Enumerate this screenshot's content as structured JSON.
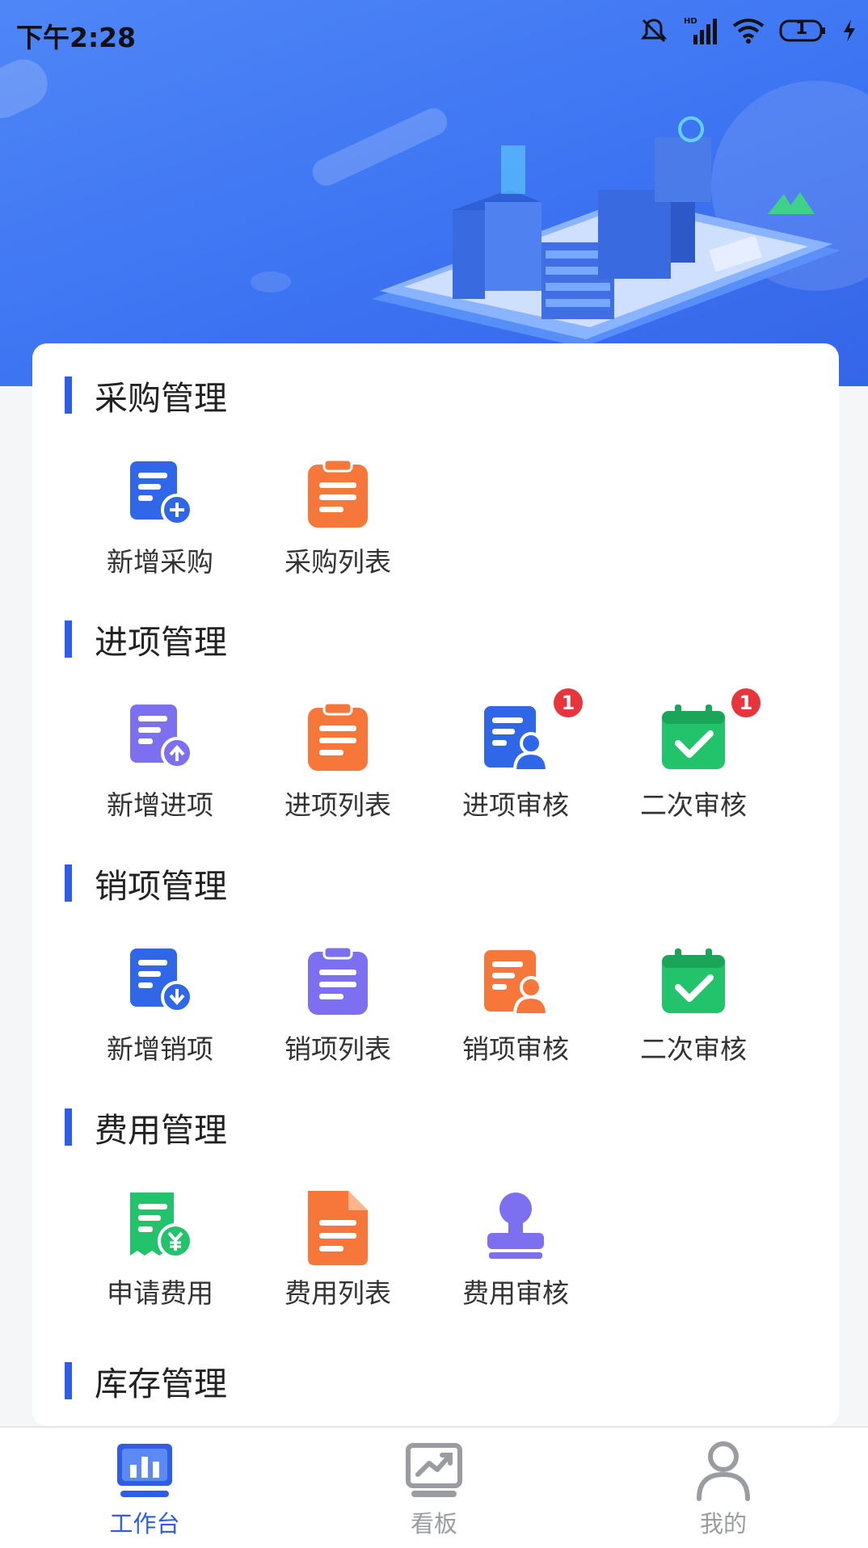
{
  "status_bar": {
    "time": "下午2:28",
    "battery": "1",
    "network": "HD"
  },
  "sections": [
    {
      "title": "采购管理",
      "items": [
        {
          "label": "新增采购",
          "icon": "doc-add-icon",
          "badge": ""
        },
        {
          "label": "采购列表",
          "icon": "clipboard-list-icon",
          "badge": ""
        }
      ]
    },
    {
      "title": "进项管理",
      "items": [
        {
          "label": "新增进项",
          "icon": "doc-upload-icon",
          "badge": ""
        },
        {
          "label": "进项列表",
          "icon": "clipboard-list-icon",
          "badge": ""
        },
        {
          "label": "进项审核",
          "icon": "doc-user-icon",
          "badge": "1"
        },
        {
          "label": "二次审核",
          "icon": "calendar-check-icon",
          "badge": "1"
        }
      ]
    },
    {
      "title": "销项管理",
      "items": [
        {
          "label": "新增销项",
          "icon": "doc-download-icon",
          "badge": ""
        },
        {
          "label": "销项列表",
          "icon": "clipboard-list-icon",
          "badge": ""
        },
        {
          "label": "销项审核",
          "icon": "doc-user-icon",
          "badge": ""
        },
        {
          "label": "二次审核",
          "icon": "calendar-check-icon",
          "badge": ""
        }
      ]
    },
    {
      "title": "费用管理",
      "items": [
        {
          "label": "申请费用",
          "icon": "receipt-yen-icon",
          "badge": ""
        },
        {
          "label": "费用列表",
          "icon": "file-lines-icon",
          "badge": ""
        },
        {
          "label": "费用审核",
          "icon": "stamp-icon",
          "badge": ""
        }
      ]
    },
    {
      "title": "库存管理",
      "items": []
    }
  ],
  "tabs": [
    {
      "label": "工作台",
      "icon": "dashboard-icon",
      "active": true
    },
    {
      "label": "看板",
      "icon": "chart-board-icon",
      "active": false
    },
    {
      "label": "我的",
      "icon": "person-icon",
      "active": false
    }
  ],
  "colors": {
    "header": "#3d74f2",
    "accent": "#2f5de5",
    "blue": "#2f67e8",
    "orange": "#f7773a",
    "purple": "#7c6ff0",
    "green": "#22c36a",
    "badge": "#e8353b"
  }
}
